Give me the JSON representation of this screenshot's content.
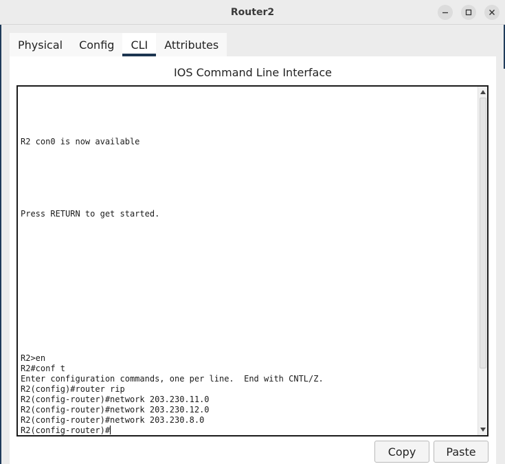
{
  "window": {
    "title": "Router2"
  },
  "tabs": [
    {
      "label": "Physical"
    },
    {
      "label": "Config"
    },
    {
      "label": "CLI"
    },
    {
      "label": "Attributes"
    }
  ],
  "active_tab": "CLI",
  "panel": {
    "title": "IOS Command Line Interface"
  },
  "terminal": {
    "lines": [
      "R2 con0 is now available",
      "Press RETURN to get started.",
      "R2>en",
      "R2#conf t",
      "Enter configuration commands, one per line.  End with CNTL/Z.",
      "R2(config)#router rip",
      "R2(config-router)#network 203.230.11.0",
      "R2(config-router)#network 203.230.12.0",
      "R2(config-router)#network 203.230.8.0",
      "R2(config-router)#"
    ]
  },
  "buttons": {
    "copy": "Copy",
    "paste": "Paste"
  },
  "icons": {
    "minimize": "minimize-icon",
    "maximize": "maximize-icon",
    "close": "close-icon",
    "scroll_up": "scroll-up-arrow-icon",
    "scroll_down": "scroll-down-arrow-icon"
  }
}
